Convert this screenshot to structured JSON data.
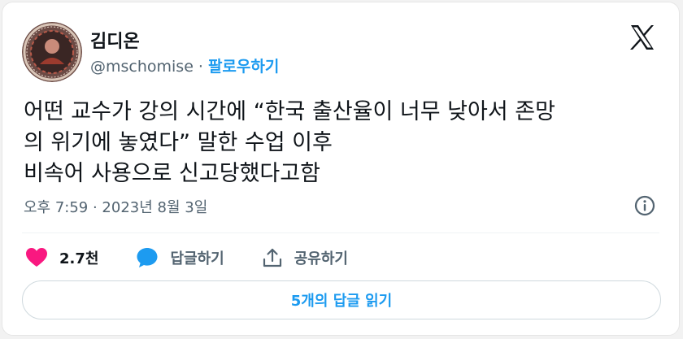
{
  "author": {
    "name": "김디온",
    "handle": "@mschomise",
    "separator": "·",
    "follow_label": "팔로우하기"
  },
  "tweet": {
    "lines": [
      "어떤 교수가 강의 시간에 “한국 출산율이 너무 낮아서 존망",
      "의 위기에 놓였다” 말한 수업 이후",
      "비속어 사용으로 신고당했다고함"
    ],
    "timestamp": "오후 7:59 · 2023년 8월 3일"
  },
  "actions": {
    "likes_count": "2.7천",
    "reply_label": "답글하기",
    "share_label": "공유하기"
  },
  "read_replies_label": "5개의 답글 읽기",
  "icons": {
    "avatar": "avatar",
    "logo": "x-logo-icon",
    "info": "info-icon",
    "like": "heart-icon",
    "reply": "speech-bubble-icon",
    "share": "share-icon"
  },
  "colors": {
    "accent": "#1d9bf0",
    "like": "#f91880",
    "secondary_text": "#536471",
    "text": "#0f1419"
  }
}
